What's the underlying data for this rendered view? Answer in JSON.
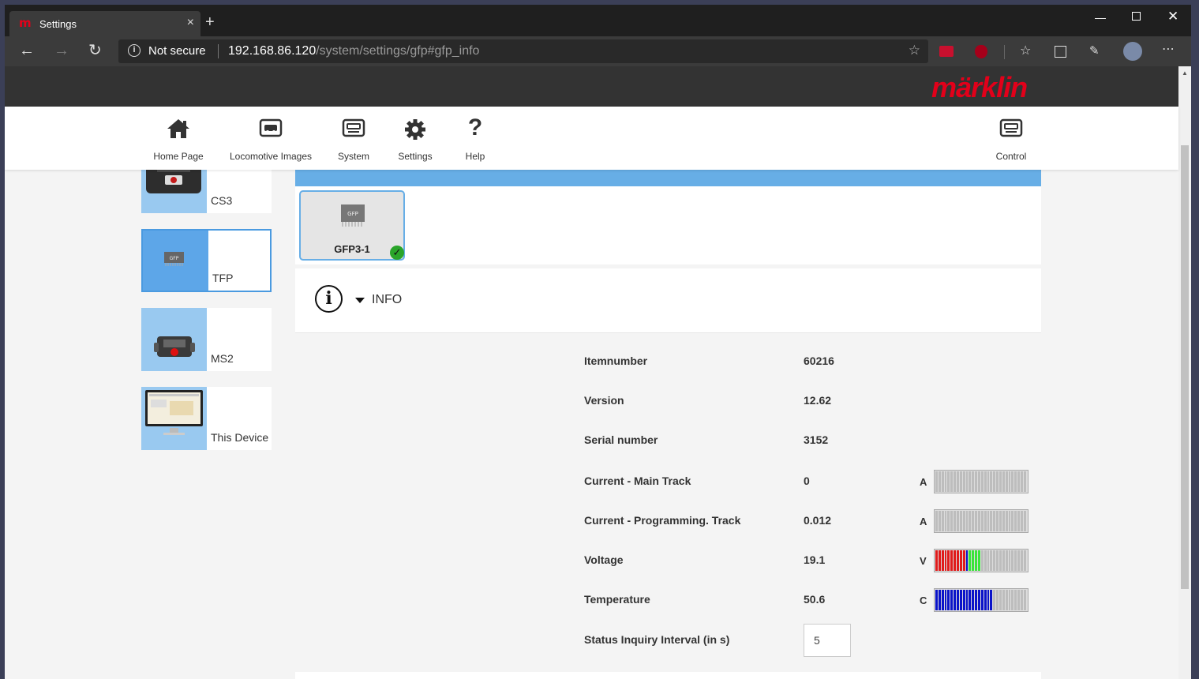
{
  "browser": {
    "tab_title": "Settings",
    "tab_favicon": "m",
    "tab_close": "×",
    "new_tab": "+",
    "address": {
      "security_label": "Not secure",
      "url_host": "192.168.86.120",
      "url_path": "/system/settings/gfp#gfp_info"
    }
  },
  "brand": {
    "logo_text": "märklin",
    "color": "#e2001a"
  },
  "menu": {
    "items": [
      {
        "label": "Home Page",
        "icon": "home-icon"
      },
      {
        "label": "Locomotive Images",
        "icon": "locomotive-icon"
      },
      {
        "label": "System",
        "icon": "system-icon"
      },
      {
        "label": "Settings",
        "icon": "gear-icon"
      },
      {
        "label": "Help",
        "icon": "help-icon"
      }
    ],
    "control": {
      "label": "Control",
      "icon": "control-icon"
    }
  },
  "sidebar": {
    "devices": [
      {
        "name": "CS3",
        "icon": "cs3-device-icon",
        "active": false
      },
      {
        "name": "TFP",
        "icon": "gfp-chip-icon",
        "active": true
      },
      {
        "name": "MS2",
        "icon": "ms2-device-icon",
        "active": false
      },
      {
        "name": "This Device",
        "icon": "monitor-icon",
        "active": false
      }
    ]
  },
  "main": {
    "chip": {
      "label": "GFP3-1",
      "chip_text": "GFP",
      "status": "ok"
    },
    "info_section": {
      "title": "INFO"
    },
    "rows": [
      {
        "label": "Itemnumber",
        "value": "60216"
      },
      {
        "label": "Version",
        "value": "12.62"
      },
      {
        "label": "Serial number",
        "value": "3152"
      },
      {
        "label": "Current - Main Track",
        "value": "0",
        "unit": "A"
      },
      {
        "label": "Current - Programming. Track",
        "value": "0.012",
        "unit": "A"
      },
      {
        "label": "Voltage",
        "value": "19.1",
        "unit": "V"
      },
      {
        "label": "Temperature",
        "value": "50.6",
        "unit": "C"
      }
    ],
    "interval": {
      "label": "Status Inquiry Interval (in s)",
      "value": "5"
    }
  },
  "meters": {
    "segments_total": 30,
    "current_main": {
      "fill_fraction": 0.0
    },
    "current_prog": {
      "fill_fraction": 0.0
    },
    "voltage": {
      "fill_fraction": 0.5,
      "colors": [
        "red",
        "red",
        "red",
        "red",
        "red",
        "red",
        "red",
        "red",
        "red",
        "red",
        "blue",
        "green",
        "green",
        "green",
        "green"
      ]
    },
    "temperature": {
      "fill_fraction": 0.633
    }
  },
  "colors": {
    "accent": "#67aee6",
    "meter_empty": "#bdbdbd",
    "meter_red": "#e01b1b",
    "meter_green": "#3ae43a",
    "meter_blue": "#0a13c9"
  }
}
